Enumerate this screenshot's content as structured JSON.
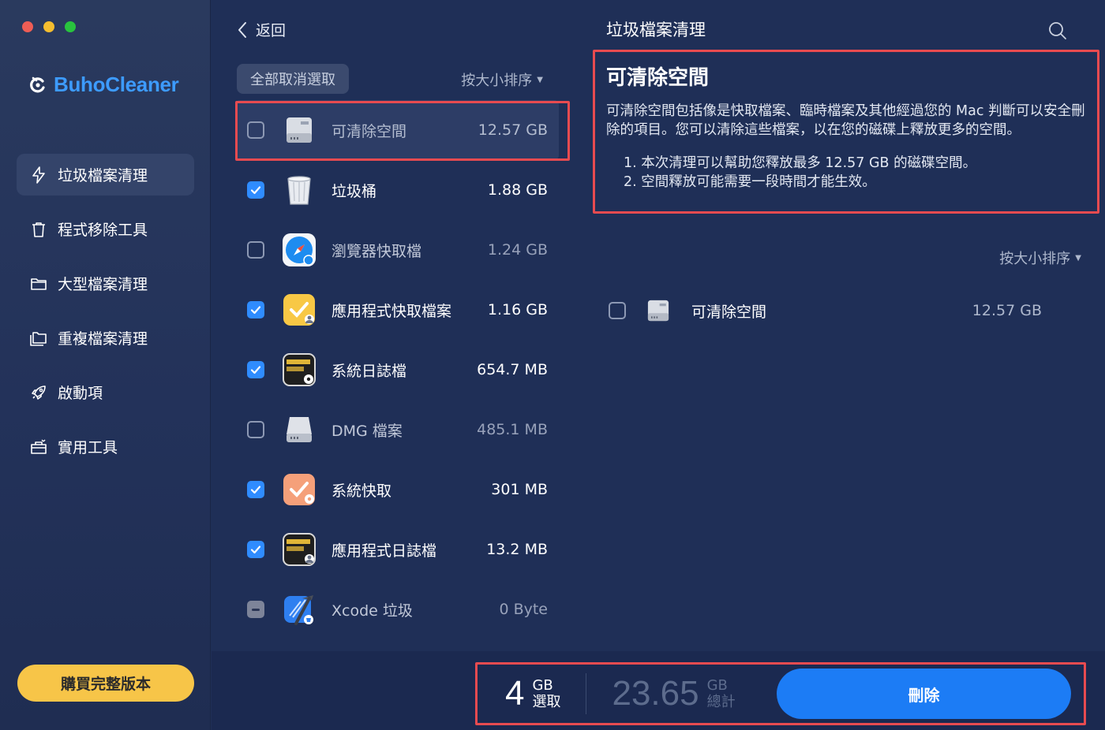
{
  "window": {
    "traffic_lights": [
      "close",
      "minimize",
      "zoom"
    ]
  },
  "sidebar": {
    "app_name": "BuhoCleaner",
    "items": [
      {
        "label": "垃圾檔案清理",
        "icon": "bolt-icon",
        "active": true
      },
      {
        "label": "程式移除工具",
        "icon": "trash-icon",
        "active": false
      },
      {
        "label": "大型檔案清理",
        "icon": "folder-icon",
        "active": false
      },
      {
        "label": "重複檔案清理",
        "icon": "duplicate-folder-icon",
        "active": false
      },
      {
        "label": "啟動項",
        "icon": "rocket-icon",
        "active": false
      },
      {
        "label": "實用工具",
        "icon": "toolbox-icon",
        "active": false
      }
    ],
    "buy_label": "購買完整版本"
  },
  "middle": {
    "back_label": "返回",
    "deselect_all": "全部取消選取",
    "sort_label": "按大小排序",
    "rows": [
      {
        "name": "可清除空間",
        "size": "12.57 GB",
        "state": "unchecked",
        "icon": "drive-icon"
      },
      {
        "name": "垃圾桶",
        "size": "1.88 GB",
        "state": "checked",
        "icon": "trash-bin-icon"
      },
      {
        "name": "瀏覽器快取檔",
        "size": "1.24 GB",
        "state": "unchecked",
        "icon": "safari-icon"
      },
      {
        "name": "應用程式快取檔案",
        "size": "1.16 GB",
        "state": "checked",
        "icon": "app-cache-icon"
      },
      {
        "name": "系統日誌檔",
        "size": "654.7 MB",
        "state": "checked",
        "icon": "system-log-icon"
      },
      {
        "name": "DMG 檔案",
        "size": "485.1 MB",
        "state": "unchecked",
        "icon": "dmg-drive-icon"
      },
      {
        "name": "系統快取",
        "size": "301 MB",
        "state": "checked",
        "icon": "system-cache-icon"
      },
      {
        "name": "應用程式日誌檔",
        "size": "13.2 MB",
        "state": "checked",
        "icon": "app-log-icon"
      },
      {
        "name": "Xcode 垃圾",
        "size": "0 Byte",
        "state": "mixed",
        "icon": "xcode-icon"
      }
    ]
  },
  "right": {
    "title": "垃圾檔案清理",
    "info_title": "可清除空間",
    "info_body": "可清除空間包括像是快取檔案、臨時檔案及其他經過您的 Mac 判斷可以安全刪除的項目。您可以清除這些檔案，以在您的磁碟上釋放更多的空間。",
    "info_points": [
      "1. 本次清理可以幫助您釋放最多 12.57 GB 的磁碟空間。",
      "2. 空間釋放可能需要一段時間才能生效。"
    ],
    "sort_label": "按大小排序",
    "detail_row": {
      "name": "可清除空間",
      "size": "12.57 GB",
      "state": "unchecked"
    }
  },
  "bottom": {
    "selected_value": "4",
    "selected_unit": "GB",
    "selected_label": "選取",
    "total_value": "23.65",
    "total_unit": "GB",
    "total_label": "總計",
    "delete_label": "刪除"
  },
  "colors": {
    "accent": "#2f8cff",
    "buy": "#f7c548",
    "annotation": "#e84b50"
  }
}
